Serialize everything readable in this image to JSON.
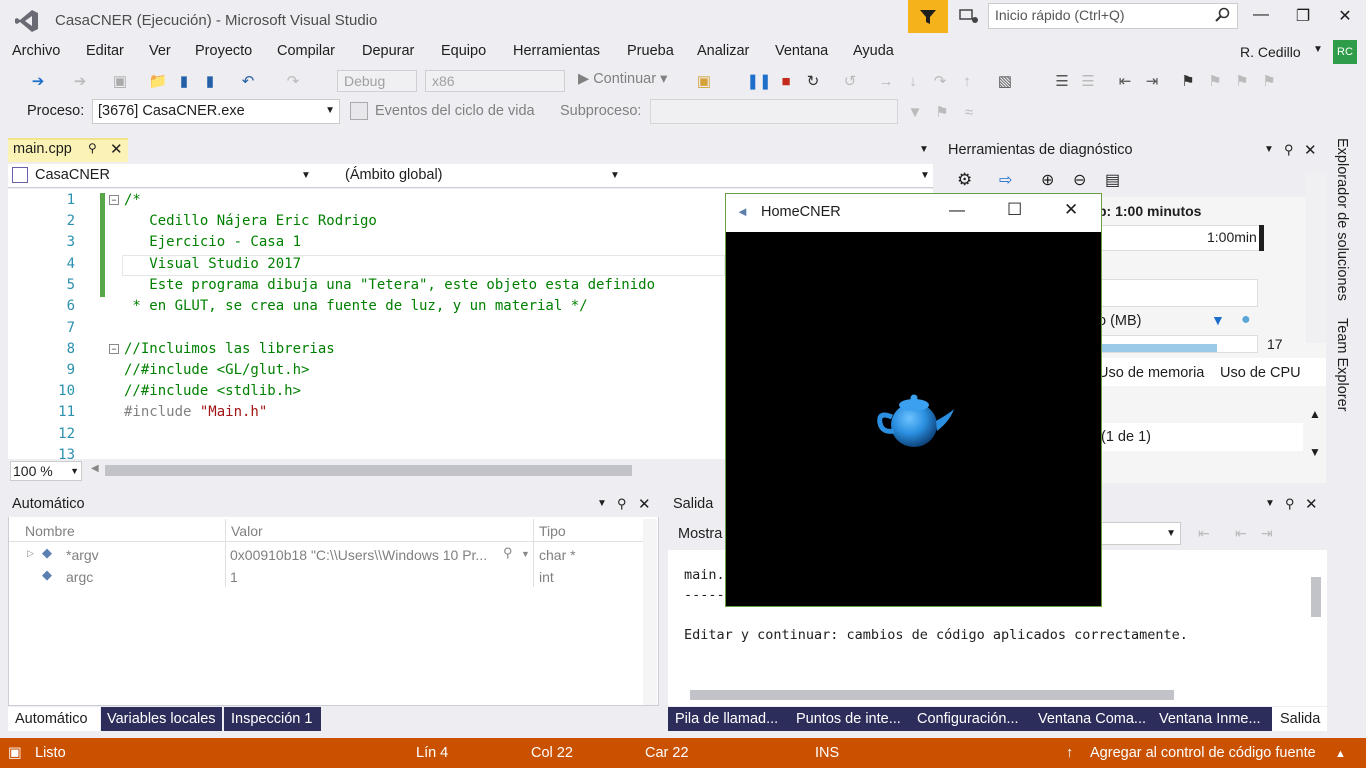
{
  "window": {
    "title": "CasaCNER (Ejecución) - Microsoft Visual Studio",
    "quick_launch_placeholder": "Inicio rápido (Ctrl+Q)"
  },
  "menu": [
    "Archivo",
    "Editar",
    "Ver",
    "Proyecto",
    "Compilar",
    "Depurar",
    "Equipo",
    "Herramientas",
    "Prueba",
    "Analizar",
    "Ventana",
    "Ayuda"
  ],
  "user": {
    "name": "R. Cedillo",
    "initials": "RC"
  },
  "toolbar": {
    "config": "Debug",
    "platform": "x86",
    "continue": "Continuar"
  },
  "debug_toolbar": {
    "process_label": "Proceso:",
    "process_value": "[3676] CasaCNER.exe",
    "events_label": "Eventos del ciclo de vida",
    "thread_label": "Subproceso:"
  },
  "editor": {
    "tab": "main.cpp",
    "nav_project": "CasaCNER",
    "nav_scope": "(Ámbito global)",
    "zoom": "100 %",
    "lines": [
      {
        "n": "1",
        "text": "/*"
      },
      {
        "n": "2",
        "text": "   Cedillo Nájera Eric Rodrigo"
      },
      {
        "n": "3",
        "text": "   Ejercicio - Casa 1"
      },
      {
        "n": "4",
        "text": "   Visual Studio 2017"
      },
      {
        "n": "5",
        "text": "   Este programa dibuja una \"Tetera\", este objeto esta definido"
      },
      {
        "n": "6",
        "text": " * en GLUT, se crea una fuente de luz, y un material */"
      },
      {
        "n": "7",
        "text": ""
      },
      {
        "n": "8",
        "text": "//Incluimos las librerias"
      },
      {
        "n": "9",
        "text": "//#include <GL/glut.h>"
      },
      {
        "n": "10",
        "text": "//#include <stdlib.h>"
      },
      {
        "n": "11",
        "pp": "#include ",
        "str": "\"Main.h\""
      },
      {
        "n": "12",
        "text": ""
      },
      {
        "n": "13",
        "text": ""
      }
    ]
  },
  "autos": {
    "title": "Automático",
    "columns": [
      "Nombre",
      "Valor",
      "Tipo"
    ],
    "rows": [
      {
        "name": "*argv",
        "value": "0x00910b18 \"C:\\\\Users\\\\Windows 10 Pr...",
        "type": "char *"
      },
      {
        "name": "argc",
        "value": "1",
        "type": "int"
      }
    ],
    "tabs": [
      "Automático",
      "Variables locales",
      "Inspección 1"
    ]
  },
  "output": {
    "title": "Salida",
    "show_label": "Mostra",
    "lines": [
      "main.",
      "-----",
      "",
      "Editar y continuar: cambios de código aplicados correctamente."
    ],
    "tabs": [
      "Pila de llamad...",
      "Puntos de inte...",
      "Configuración...",
      "Ventana Coma...",
      "Ventana Inme...",
      "Salida"
    ]
  },
  "diagnostics": {
    "title": "Herramientas de diagnóstico",
    "session": "p: 1:00 minutos",
    "timeline_label": "1:00min",
    "memory_label": "o (MB)",
    "memory_value": "17",
    "tab_memory": "Uso de memoria",
    "tab_cpu": "Uso de CPU",
    "events_count": "(1 de 1)"
  },
  "side_tabs": [
    "Explorador de soluciones",
    "Team Explorer"
  ],
  "app_window": {
    "title": "HomeCNER"
  },
  "status": {
    "ready": "Listo",
    "line": "Lín 4",
    "col": "Col 22",
    "char": "Car 22",
    "mode": "INS",
    "source_control": "Agregar al control de código fuente"
  },
  "colors": {
    "status_bar": "#ca5100",
    "bottom_tabs": "#2d2d5c",
    "filter": "#f6b21a",
    "avatar": "#2f9c49"
  }
}
